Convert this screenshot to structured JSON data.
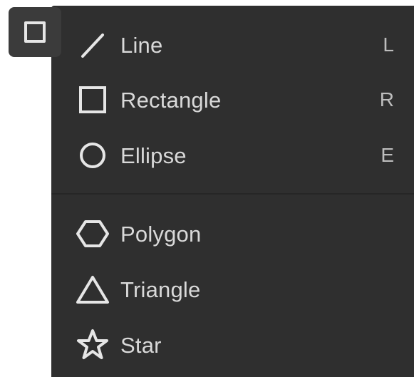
{
  "tool_button": {
    "icon": "square-icon"
  },
  "menu": {
    "groups": [
      {
        "items": [
          {
            "label": "Line",
            "shortcut": "L",
            "icon": "line-icon"
          },
          {
            "label": "Rectangle",
            "shortcut": "R",
            "icon": "rectangle-icon"
          },
          {
            "label": "Ellipse",
            "shortcut": "E",
            "icon": "ellipse-icon"
          }
        ]
      },
      {
        "items": [
          {
            "label": "Polygon",
            "icon": "polygon-icon"
          },
          {
            "label": "Triangle",
            "icon": "triangle-icon"
          },
          {
            "label": "Star",
            "icon": "star-icon"
          }
        ]
      }
    ]
  },
  "colors": {
    "menu_background": "#2f2f2f",
    "button_background": "#3b3b3b",
    "text": "#d9d9d9",
    "icon_stroke": "#e6e6e6"
  }
}
